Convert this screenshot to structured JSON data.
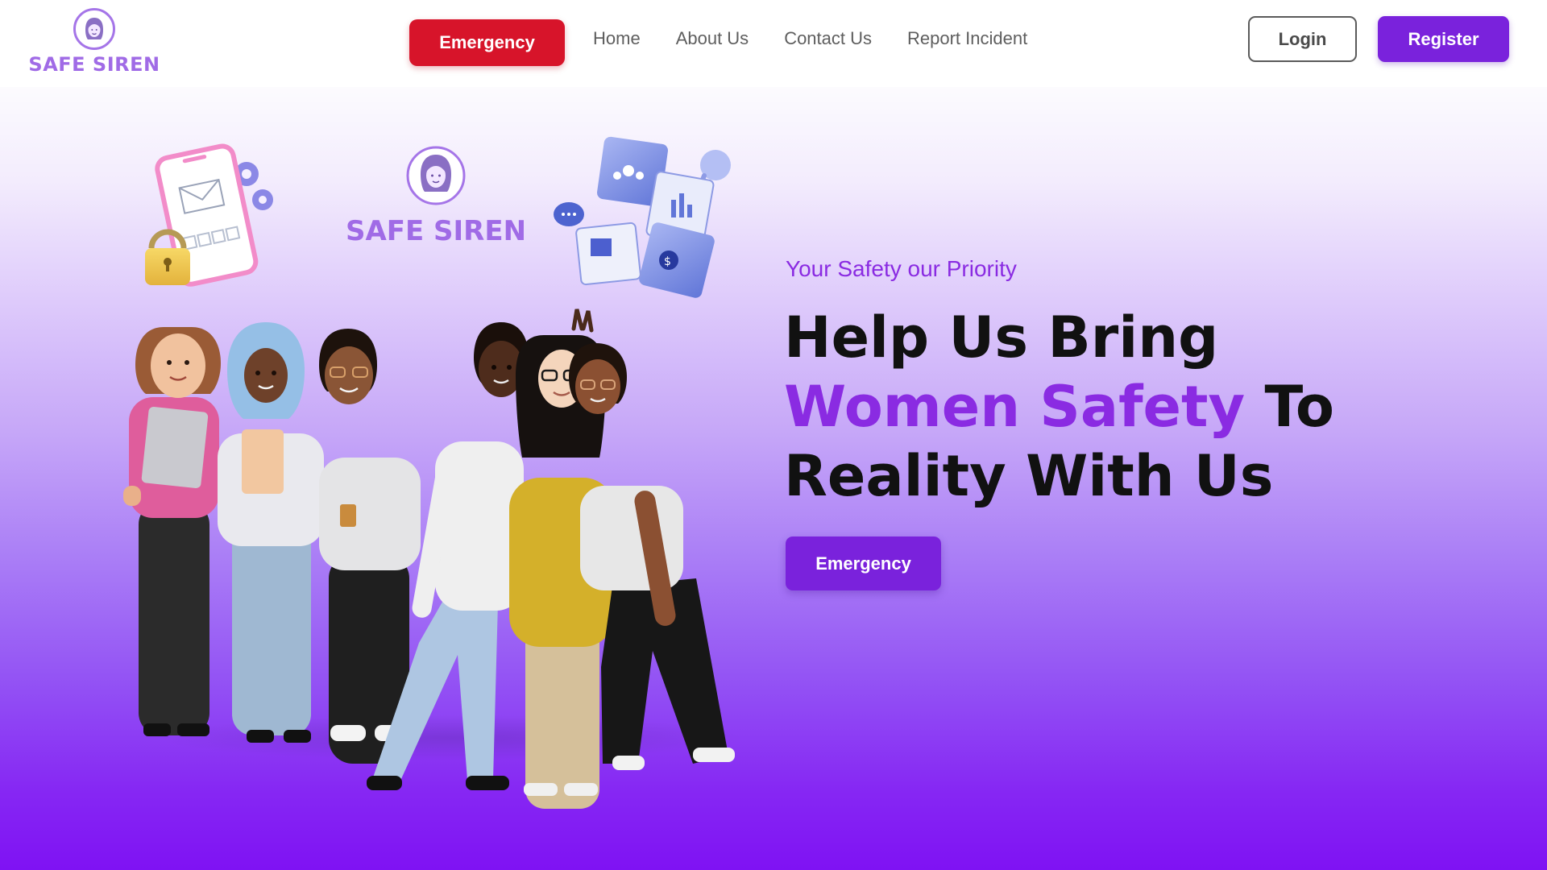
{
  "brand": {
    "name": "SAFE SIREN",
    "accent_color": "#8a2be2",
    "emergency_color": "#d7142a"
  },
  "nav": {
    "emergency_label": "Emergency",
    "links": [
      "Home",
      "About Us",
      "Contact Us",
      "Report Incident"
    ],
    "login_label": "Login",
    "register_label": "Register"
  },
  "hero": {
    "illustration_logo_text": "SAFE SIREN",
    "tagline": "Your Safety our Priority",
    "headline_line1": "Help Us Bring",
    "headline_accent": "Women Safety",
    "headline_line2_rest": " To",
    "headline_line3": "Reality With Us",
    "cta_label": "Emergency"
  },
  "icons": {
    "logo": "woman-face-icon",
    "phone": "phone-mail-lock-icon",
    "puzzle": "puzzle-analytics-icon"
  }
}
